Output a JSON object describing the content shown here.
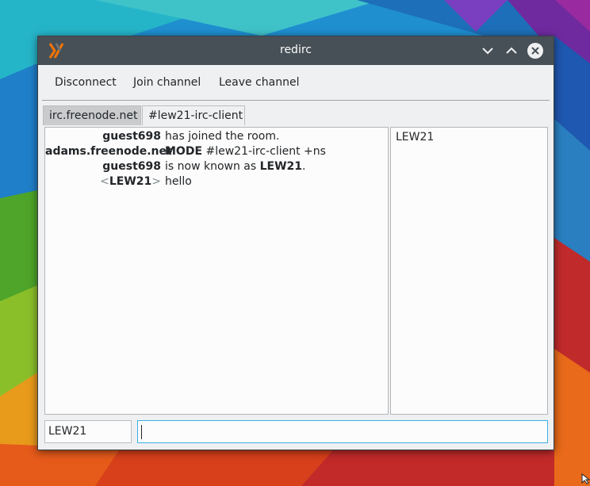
{
  "window": {
    "title": "redirc",
    "icon": "x-logo-icon"
  },
  "titlebar_buttons": [
    "minimize-icon",
    "maximize-icon",
    "close-icon"
  ],
  "menu": {
    "disconnect": "Disconnect",
    "join_channel": "Join channel",
    "leave_channel": "Leave channel"
  },
  "tabs": [
    {
      "label": "irc.freenode.net",
      "active": false
    },
    {
      "label": "#lew21-irc-client",
      "active": true
    }
  ],
  "messages": [
    {
      "sender": "guest698",
      "text": "has joined the room."
    },
    {
      "sender": "adams.freenode.net",
      "command": "MODE",
      "text": "#lew21-irc-client +ns"
    },
    {
      "sender": "guest698",
      "text_before": "is now known as",
      "text_bold": "LEW21",
      "text_after": "."
    },
    {
      "sender_open": "<",
      "sender": "LEW21",
      "sender_close": ">",
      "text": "hello"
    }
  ],
  "users": [
    "LEW21"
  ],
  "nick_field": {
    "value": "LEW21"
  },
  "message_input": {
    "value": ""
  },
  "colors": {
    "titlebar": "#475057",
    "window_bg": "#eff0f1",
    "pane_bg": "#fcfcfc",
    "focus_accent": "#3daee9",
    "active_tab": "#c9cbcd"
  }
}
